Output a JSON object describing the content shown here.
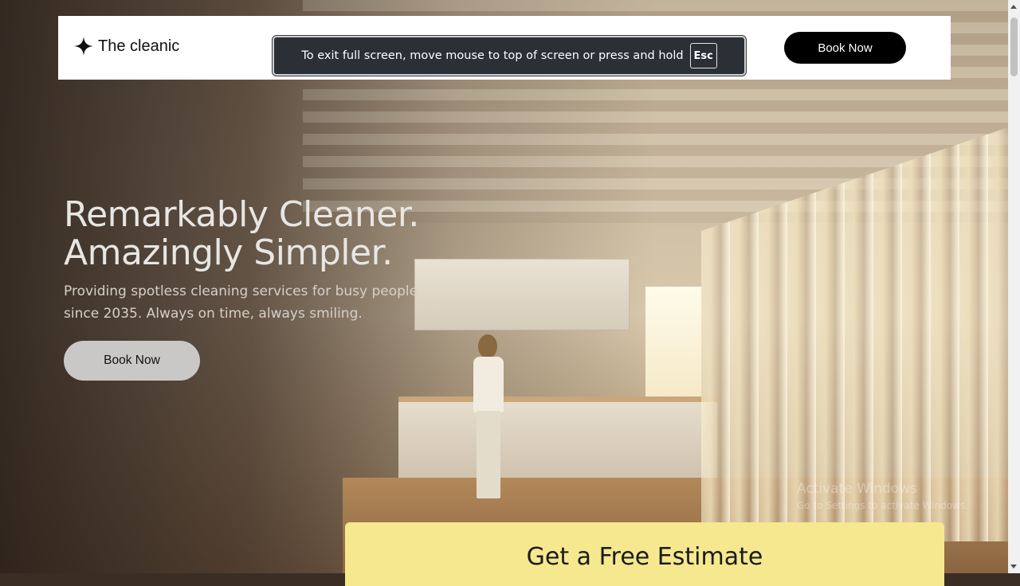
{
  "nav": {
    "logo_text": "The cleanic",
    "logo_icon": "sparkle-star-icon",
    "book_label": "Book Now"
  },
  "fullscreen_toast": {
    "message": "To exit full screen, move mouse to top of screen or press and hold",
    "key": "Esc"
  },
  "hero": {
    "title_line1": "Remarkably Cleaner.",
    "title_line2": "Amazingly Simpler.",
    "subtitle_line1": "Providing spotless cleaning services for busy people",
    "subtitle_line2": "since 2035. Always on time, always smiling.",
    "book_label": "Book Now"
  },
  "estimate": {
    "title": "Get a Free Estimate"
  },
  "watermark": {
    "line1": "Activate Windows",
    "line2": "Go to Settings to activate Windows."
  },
  "colors": {
    "nav_background": "#ffffff",
    "primary_button": "#000000",
    "hero_button": "#c9c8c6",
    "estimate_card": "#f6e88e",
    "toast_background": "#2b2f36"
  }
}
